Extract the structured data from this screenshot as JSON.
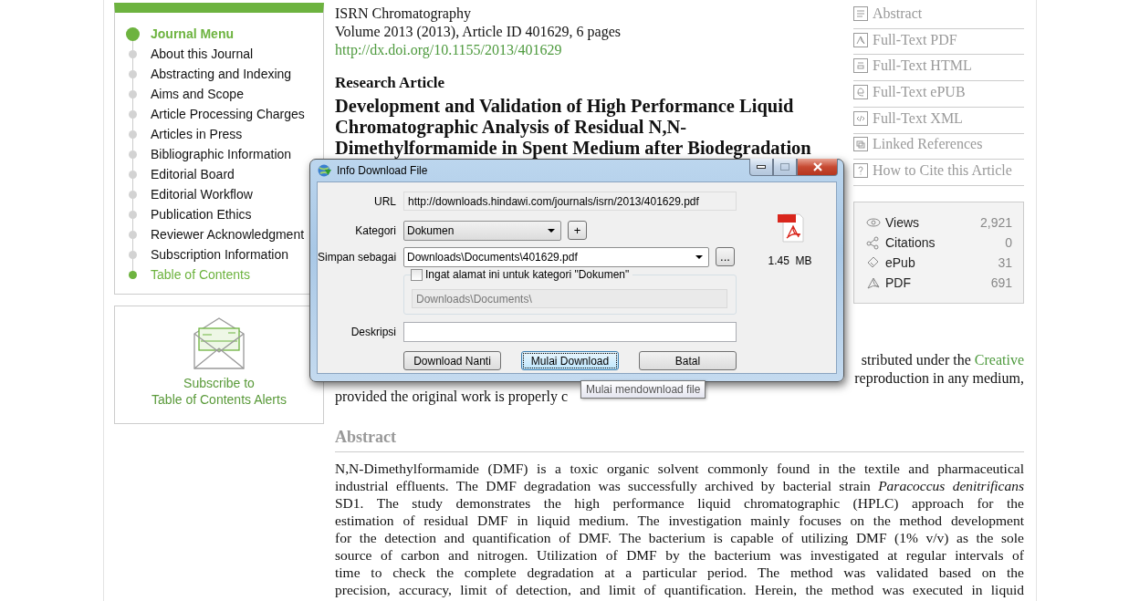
{
  "journal_menu": {
    "title": "Journal Menu",
    "items": [
      {
        "label": "About this Journal",
        "selected": false
      },
      {
        "label": "Abstracting and Indexing",
        "selected": false
      },
      {
        "label": "Aims and Scope",
        "selected": false
      },
      {
        "label": "Article Processing Charges",
        "selected": false
      },
      {
        "label": "Articles in Press",
        "selected": false
      },
      {
        "label": "Bibliographic Information",
        "selected": false
      },
      {
        "label": "Editorial Board",
        "selected": false
      },
      {
        "label": "Editorial Workflow",
        "selected": false
      },
      {
        "label": "Publication Ethics",
        "selected": false
      },
      {
        "label": "Reviewer Acknowledgment",
        "selected": false
      },
      {
        "label": "Subscription Information",
        "selected": false
      },
      {
        "label": "Table of Contents",
        "selected": true
      }
    ]
  },
  "subscribe": {
    "lines": [
      "Subscribe to",
      "Table of Contents Alerts"
    ]
  },
  "article": {
    "journal": "ISRN Chromatography",
    "volume": "Volume 2013 (2013), Article ID 401629, 6 pages",
    "doi": "http://dx.doi.org/10.1155/2013/401629",
    "type": "Research Article",
    "title": "Development and Validation of High Performance Liquid Chromatographic Analysis of Residual N,N-Dimethylformamide in Spent Medium after Biodegradation"
  },
  "article_links": [
    {
      "label": "Abstract",
      "kind": "lines"
    },
    {
      "label": "Full-Text PDF",
      "kind": "pdf"
    },
    {
      "label": "Full-Text HTML",
      "kind": "html"
    },
    {
      "label": "Full-Text ePUB",
      "kind": "epub"
    },
    {
      "label": "Full-Text XML",
      "kind": "xml"
    },
    {
      "label": "Linked References",
      "kind": "refs"
    },
    {
      "label": "How to Cite this Article",
      "kind": "cite"
    }
  ],
  "stats": [
    {
      "label": "Views",
      "value": "2,921",
      "kind": "views"
    },
    {
      "label": "Citations",
      "value": "0",
      "kind": "citations"
    },
    {
      "label": "ePub",
      "value": "31",
      "kind": "epub"
    },
    {
      "label": "PDF",
      "value": "691",
      "kind": "pdf"
    }
  ],
  "license": {
    "line_1": "stributed under the",
    "link": "Creative",
    "line_2": "reproduction in any medium,",
    "line_3": "provided the original work is properly c"
  },
  "abstract": {
    "heading": "Abstract",
    "lines": [
      "N,N-Dimethylformamide (DMF) is a toxic organic solvent commonly found in the textile and pharmaceutical",
      "industrial effluents. The DMF degradation was successfully archived by bacterial strain *Paracoccus denitrificans*",
      "SD1. The study demonstrates the high performance liquid chromatographic (HPLC) approach for the",
      "estimation of residual DMF in liquid medium. The investigation mainly focuses on the method development",
      "for the detection and quantification of DMF. The bacterium is capable of utilizing DMF (1% v/v) as the sole",
      "source of carbon and nitrogen. Utilization of DMF by the bacterium was investigated at regular intervals of",
      "time to check the complete degradation at a particular period. The method was validated based on the",
      "precision, accuracy, limit of detection, and limit of quantification. Herein, the method was executed in liquid"
    ]
  },
  "dialog": {
    "title": "Info Download File",
    "url_label": "URL",
    "url": "http://downloads.hindawi.com/journals/isrn/2013/401629.pdf",
    "category_label": "Kategori",
    "category": "Dokumen",
    "add_button": "+",
    "save_label": "Simpan sebagai",
    "save_path": "Downloads\\Documents\\401629.pdf",
    "browse_button": "...",
    "remember": {
      "label": "Ingat alamat ini untuk kategori \"Dokumen\"",
      "checked": false
    },
    "remember_path": "Downloads\\Documents\\",
    "description_label": "Deskripsi",
    "file_size": "1.45  MB",
    "buttons": [
      {
        "label": "Download Nanti",
        "focused": false
      },
      {
        "label": "Mulai Download",
        "focused": true
      },
      {
        "label": "Batal",
        "focused": false
      }
    ],
    "tooltip": "Mulai mendownload file"
  }
}
